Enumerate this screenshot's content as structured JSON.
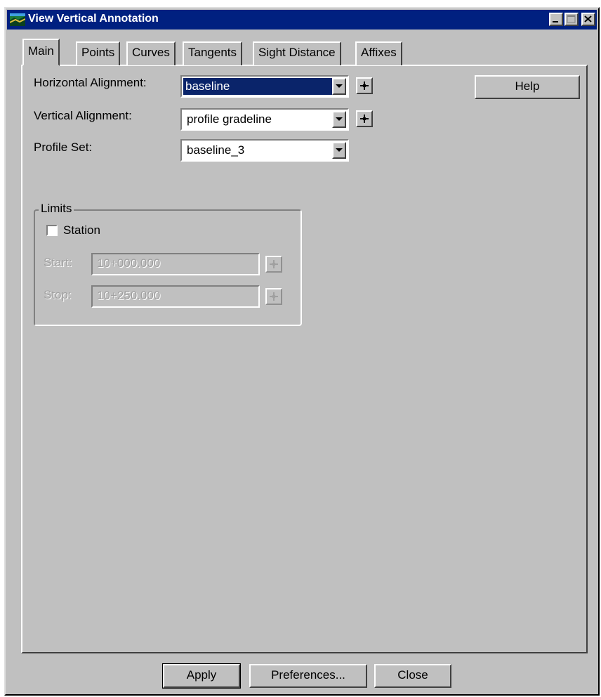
{
  "window": {
    "title": "View Vertical Annotation",
    "icon": "application-icon",
    "controls": [
      "minimize-icon",
      "maximize-icon",
      "close-icon"
    ]
  },
  "tabs": [
    {
      "label": "Main",
      "active": true
    },
    {
      "label": "Points",
      "active": false
    },
    {
      "label": "Curves",
      "active": false
    },
    {
      "label": "Tangents",
      "active": false
    },
    {
      "label": "Sight Distance",
      "active": false
    },
    {
      "label": "Affixes",
      "active": false
    }
  ],
  "main": {
    "horizontal_alignment": {
      "label": "Horizontal Alignment:",
      "value": "baseline"
    },
    "vertical_alignment": {
      "label": "Vertical Alignment:",
      "value": "profile gradeline"
    },
    "profile_set": {
      "label": "Profile Set:",
      "value": "baseline_3"
    },
    "help_label": "Help",
    "limits": {
      "legend": "Limits",
      "station_label": "Station",
      "station_checked": false,
      "start_label": "Start:",
      "start_value": "10+000.000",
      "stop_label": "Stop:",
      "stop_value": "10+250.000"
    }
  },
  "footer": {
    "apply_label": "Apply",
    "preferences_label": "Preferences...",
    "close_label": "Close"
  },
  "colors": {
    "titlebar": "#002080",
    "dialog_face": "#c0c0c0",
    "selection": "#0a246a"
  }
}
